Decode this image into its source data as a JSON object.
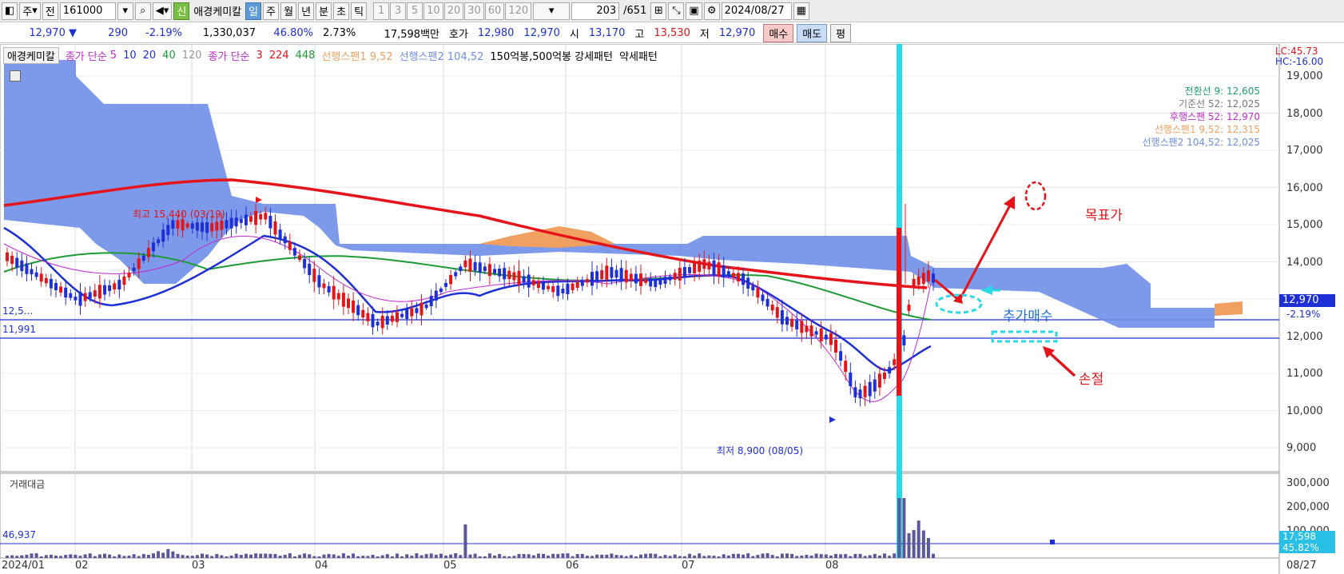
{
  "toolbar": {
    "market": "주",
    "prev": "전",
    "code": "161000",
    "credit": "신",
    "name": "애경케미칼",
    "periods": [
      "일",
      "주",
      "월",
      "년",
      "분",
      "초",
      "틱"
    ],
    "active_period": "일",
    "intervals": [
      "1",
      "3",
      "5",
      "10",
      "20",
      "30",
      "60",
      "120"
    ],
    "count": "203",
    "total": "/651",
    "date": "2024/08/27"
  },
  "infobar": {
    "price": "12,970",
    "change": "290",
    "pct": "-2.19%",
    "volume": "1,330,037",
    "vol_ratio": "46.80%",
    "turnover": "2.73%",
    "amount": "17,598백만",
    "quote_label": "호가",
    "ask": "12,980",
    "bid": "12,970",
    "open_label": "시",
    "open": "13,170",
    "high_label": "고",
    "high": "13,530",
    "low_label": "저",
    "low": "12,970",
    "buy": "매수",
    "sell": "매도",
    "eval": "평"
  },
  "legend": {
    "name": "애경케미칼",
    "ma_label": "종가 단순",
    "ma1": "5",
    "ma2": "10",
    "ma3": "20",
    "ma4": "40",
    "ma5": "120",
    "ma_label2": "종가 단순",
    "ma6": "3",
    "ma7": "224",
    "ma8": "448",
    "span1": "선행스팬1 9,52",
    "span2": "선행스팬2 104,52",
    "pattern": "150억봉,500억봉 강세패턴",
    "weak": "약세패턴"
  },
  "right_legend": {
    "lc": "LC:45.73",
    "hc": "HC:-16.00"
  },
  "ichimoku_values": [
    {
      "label": "전환선 9: 12,605",
      "color": "#1f9e6e"
    },
    {
      "label": "기준선 52: 12,025",
      "color": "#777777"
    },
    {
      "label": "후행스팬 52: 12,970",
      "color": "#c02bd0"
    },
    {
      "label": "선행스팬1 9,52: 12,315",
      "color": "#f0a060"
    },
    {
      "label": "선행스팬2 104,52: 12,025",
      "color": "#6f8fe8"
    }
  ],
  "annotations": {
    "high_note": "최고 15,440 (03/19)",
    "low_note": "최저 8,900 (08/05)",
    "target": "목표가",
    "add_buy": "추가매수",
    "stop_loss": "손절",
    "line_upper": "12,5...",
    "line_lower": "11,991"
  },
  "y_axis": [
    "19,000",
    "18,000",
    "17,000",
    "16,000",
    "15,000",
    "14,000",
    "13,000",
    "12,000",
    "11,000",
    "10,000",
    "9,000"
  ],
  "price_tag": {
    "value": "12,970",
    "pct": "-2.19%"
  },
  "volume_panel": {
    "title": "거래대금",
    "ref": "46,937",
    "y_axis": [
      "300,000",
      "200,000",
      "100,000"
    ],
    "tag_value": "17,598",
    "tag_pct": "45.82%"
  },
  "x_axis": [
    "2024/01",
    "02",
    "03",
    "04",
    "05",
    "06",
    "07",
    "08",
    "08/27"
  ],
  "colors": {
    "up": "#e4141a",
    "down": "#1e2fd6",
    "cloud": "#6f8fe8",
    "cloud_up": "#f0a060",
    "cursor": "#29d9e6",
    "ma120": "#e4141a"
  }
}
